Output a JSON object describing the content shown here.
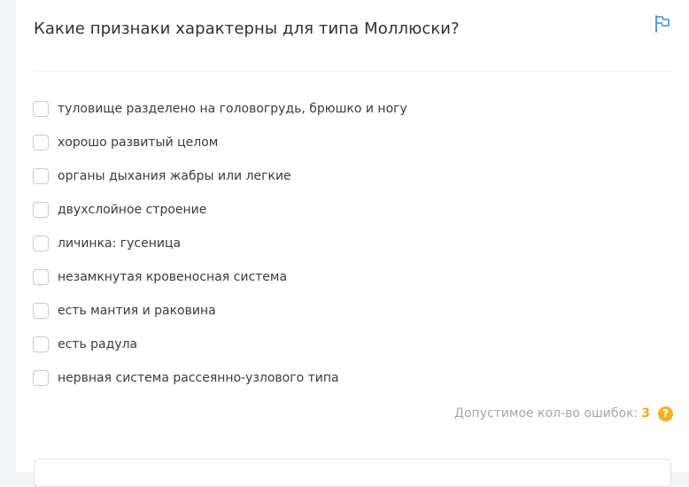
{
  "question": {
    "text": "Какие признаки характерны для типа Моллюски?"
  },
  "flag_icon": "flag-icon",
  "options": [
    {
      "label": "туловище разделено на головогрудь, брюшко и ногу",
      "checked": false
    },
    {
      "label": "хорошо развитый целом",
      "checked": false
    },
    {
      "label": "органы дыхания жабры или легкие",
      "checked": false
    },
    {
      "label": "двухслойное строение",
      "checked": false
    },
    {
      "label": "личинка: гусеница",
      "checked": false
    },
    {
      "label": "незамкнутая кровеносная система",
      "checked": false
    },
    {
      "label": "есть мантия и раковина",
      "checked": false
    },
    {
      "label": "есть радула",
      "checked": false
    },
    {
      "label": "нервная система рассеянно-узлового типа",
      "checked": false
    }
  ],
  "errors": {
    "label": "Допустимое кол-во ошибок:",
    "count": "3",
    "help_glyph": "?"
  },
  "colors": {
    "accent_blue": "#3f8ee0",
    "warning_yellow": "#f2a91d",
    "muted_text": "#a5a7ac"
  }
}
